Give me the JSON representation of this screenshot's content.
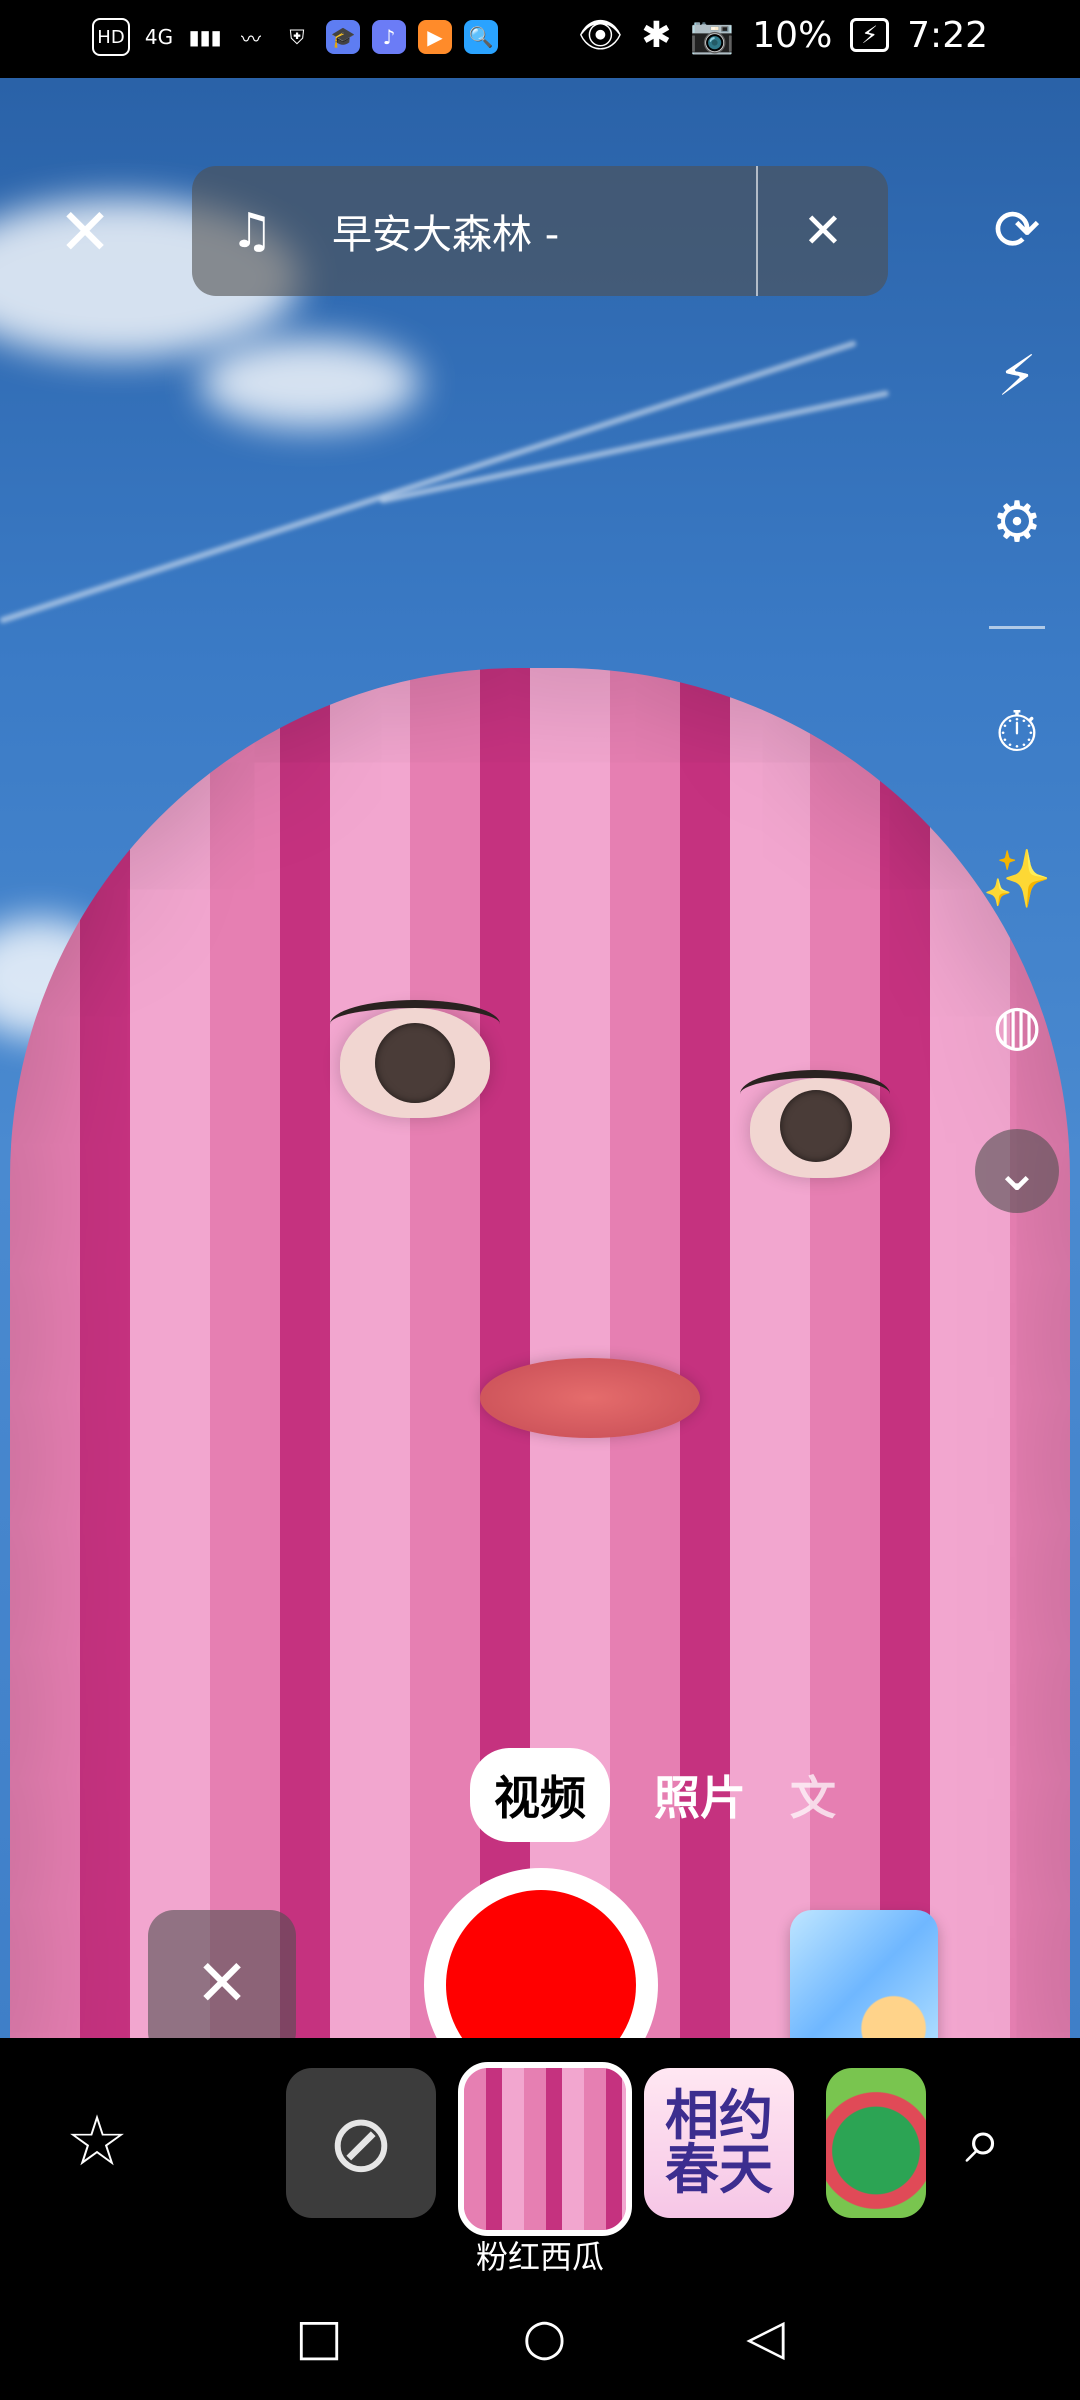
{
  "status_bar": {
    "left_badges": [
      "HD",
      "4G",
      "signal",
      "wifi",
      "shield",
      "hat",
      "music",
      "video",
      "search"
    ],
    "right": {
      "battery_percent": "10%",
      "time": "7:22"
    }
  },
  "top_bar": {
    "close_label": "✕",
    "music": {
      "note_icon": "♫",
      "song_text": "早安大森林 -",
      "close_label": "✕"
    }
  },
  "side_tools": [
    {
      "name": "flip-camera",
      "icon": "⟳"
    },
    {
      "name": "flash",
      "icon": "⚡"
    },
    {
      "name": "settings",
      "icon": "⚙"
    },
    {
      "name": "timer",
      "icon": "⏱"
    },
    {
      "name": "beauty",
      "icon": "✨"
    },
    {
      "name": "filters",
      "icon": "◍"
    },
    {
      "name": "more",
      "icon": "⌄"
    }
  ],
  "modes": [
    {
      "label": "视频",
      "active": true
    },
    {
      "label": "照片",
      "active": false
    },
    {
      "label": "文",
      "active": false
    }
  ],
  "capture": {
    "cancel_label": "✕"
  },
  "effects": {
    "favorite_icon": "☆",
    "none_icon": "⊘",
    "selected_effect": "粉红西瓜",
    "spring_text": "相约春天",
    "search_icon": "⌕"
  },
  "nav": {
    "recent_icon": "□",
    "home_icon": "○",
    "back_icon": "◁"
  }
}
